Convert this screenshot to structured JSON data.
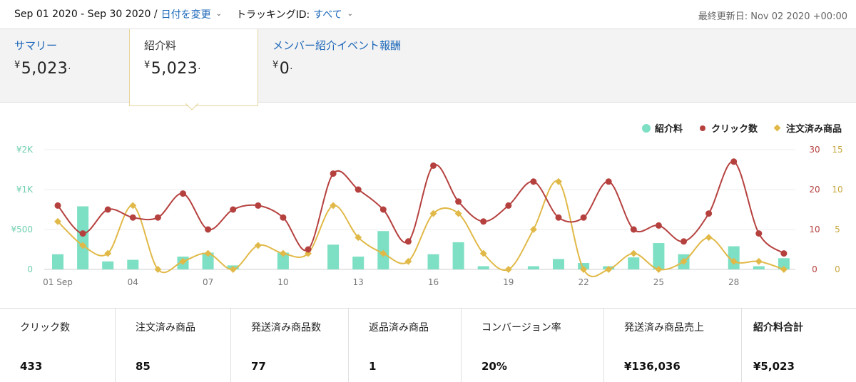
{
  "header": {
    "date_range": "Sep 01 2020 - Sep 30 2020 /",
    "change_date": "日付を変更",
    "tracking_label": "トラッキングID:",
    "tracking_value": "すべて",
    "last_updated": "最終更新日: Nov 02 2020 +00:00"
  },
  "tabs": [
    {
      "label": "サマリー",
      "value": "5,023"
    },
    {
      "label": "紹介料",
      "value": "5,023"
    },
    {
      "label": "メンバー紹介イベント報酬",
      "value": "0"
    }
  ],
  "currency_symbol": "¥",
  "legend": [
    {
      "label": "紹介料",
      "color": "#7ddfc3"
    },
    {
      "label": "クリック数",
      "color": "#b5413f"
    },
    {
      "label": "注文済み商品",
      "color": "#e1b948"
    }
  ],
  "chart_data": {
    "type": "bar+line",
    "categories": [
      "01 Sep",
      "02",
      "03",
      "04",
      "05",
      "06",
      "07",
      "08",
      "09",
      "10",
      "11",
      "12",
      "13",
      "14",
      "15",
      "16",
      "17",
      "18",
      "19",
      "20",
      "21",
      "22",
      "23",
      "24",
      "25",
      "26",
      "27",
      "28",
      "29",
      "30"
    ],
    "x_tick_labels": [
      "01 Sep",
      "04",
      "07",
      "10",
      "13",
      "16",
      "19",
      "22",
      "25",
      "28"
    ],
    "y_left_ticks": [
      "0",
      "¥500",
      "¥1K",
      "¥2K"
    ],
    "y_left_tick_values": [
      0,
      500,
      1000,
      1500
    ],
    "y_mid_ticks": [
      "0",
      "10",
      "20",
      "30"
    ],
    "y_right_ticks": [
      "0",
      "5",
      "10",
      "15"
    ],
    "series": [
      {
        "name": "紹介料",
        "axis": "left",
        "color": "#7ddfc3",
        "values": [
          190,
          790,
          100,
          120,
          0,
          160,
          210,
          50,
          0,
          210,
          0,
          310,
          160,
          480,
          0,
          190,
          340,
          40,
          0,
          40,
          130,
          80,
          40,
          150,
          330,
          190,
          0,
          290,
          40,
          140
        ]
      },
      {
        "name": "クリック数",
        "axis": "mid",
        "color": "#b5413f",
        "values": [
          16,
          9,
          15,
          13,
          13,
          19,
          10,
          15,
          16,
          13,
          5,
          24,
          20,
          15,
          7,
          26,
          17,
          12,
          16,
          22,
          13,
          13,
          22,
          10,
          11,
          7,
          14,
          27,
          9,
          4
        ]
      },
      {
        "name": "注文済み商品",
        "axis": "right",
        "color": "#e1b948",
        "values": [
          6,
          3,
          2,
          8,
          0,
          1,
          2,
          0,
          3,
          2,
          2,
          8,
          4,
          2,
          1,
          7,
          7,
          2,
          0,
          5,
          11,
          0,
          0,
          2,
          0,
          1,
          4,
          1,
          1,
          0
        ]
      }
    ]
  },
  "stats": [
    {
      "label": "クリック数",
      "value": "433"
    },
    {
      "label": "注文済み商品",
      "value": "85"
    },
    {
      "label": "発送済み商品数",
      "value": "77"
    },
    {
      "label": "返品済み商品",
      "value": "1"
    },
    {
      "label": "コンバージョン率",
      "value": "20%"
    },
    {
      "label": "発送済み商品売上",
      "value": "¥136,036"
    },
    {
      "label": "紹介料合計",
      "value": "¥5,023"
    }
  ]
}
